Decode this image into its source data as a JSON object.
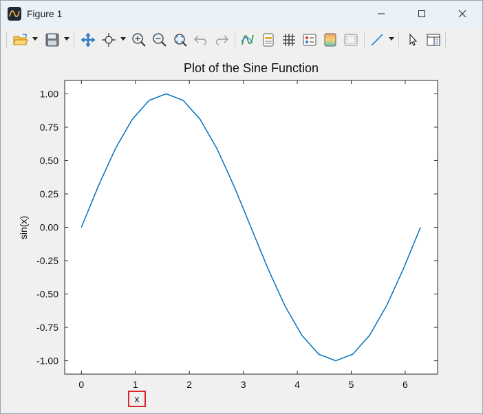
{
  "window": {
    "title": "Figure 1"
  },
  "toolbar": {
    "buttons": [
      {
        "name": "open-button",
        "icon": "folder-open-icon"
      },
      {
        "name": "save-button",
        "icon": "floppy-disk-icon"
      },
      {
        "name": "pan-button",
        "icon": "move-arrows-icon"
      },
      {
        "name": "data-cursor-button",
        "icon": "crosshair-icon"
      },
      {
        "name": "zoom-in-button",
        "icon": "zoom-in-icon"
      },
      {
        "name": "zoom-out-button",
        "icon": "zoom-out-icon"
      },
      {
        "name": "autoscale-button",
        "icon": "autoscale-icon"
      },
      {
        "name": "undo-button",
        "icon": "undo-icon"
      },
      {
        "name": "redo-button",
        "icon": "redo-icon"
      },
      {
        "name": "plot-tools-button",
        "icon": "curve-icon"
      },
      {
        "name": "insert-colorbar-button",
        "icon": "colorbar-icon"
      },
      {
        "name": "grid-button",
        "icon": "grid-icon"
      },
      {
        "name": "legend-button",
        "icon": "legend-icon"
      },
      {
        "name": "colormap-button",
        "icon": "colormap-icon"
      },
      {
        "name": "frame-button",
        "icon": "frame-icon"
      },
      {
        "name": "line-style-button",
        "icon": "line-icon"
      },
      {
        "name": "select-button",
        "icon": "pointer-icon"
      },
      {
        "name": "property-editor-button",
        "icon": "panel-icon"
      }
    ]
  },
  "chart_data": {
    "type": "line",
    "title": "Plot of the Sine Function",
    "xlabel": "x",
    "ylabel": "sin(x)",
    "xlim": [
      -0.31,
      6.6
    ],
    "ylim": [
      -1.1,
      1.1
    ],
    "xticks": [
      0,
      1,
      2,
      3,
      4,
      5,
      6
    ],
    "xtick_labels": [
      "0",
      "1",
      "2",
      "3",
      "4",
      "5",
      "6"
    ],
    "yticks": [
      1.0,
      0.75,
      0.5,
      0.25,
      0.0,
      -0.25,
      -0.5,
      -0.75,
      -1.0
    ],
    "ytick_labels": [
      "1.00",
      "0.75",
      "0.50",
      "0.25",
      "0.00",
      "-0.25",
      "-0.50",
      "-0.75",
      "-1.00"
    ],
    "grid": false,
    "series": [
      {
        "color": "#0072bd",
        "x": [
          0,
          0.3142,
          0.6283,
          0.9425,
          1.2566,
          1.5708,
          1.885,
          2.1991,
          2.5133,
          2.8274,
          3.1416,
          3.4558,
          3.7699,
          4.0841,
          4.3982,
          4.7124,
          5.0265,
          5.3407,
          5.6549,
          5.969,
          6.2832
        ],
        "y": [
          0,
          0.309,
          0.5878,
          0.809,
          0.9511,
          1.0,
          0.9511,
          0.809,
          0.5878,
          0.309,
          0,
          -0.309,
          -0.5878,
          -0.809,
          -0.9511,
          -1.0,
          -0.9511,
          -0.809,
          -0.5878,
          -0.309,
          0
        ]
      }
    ]
  }
}
